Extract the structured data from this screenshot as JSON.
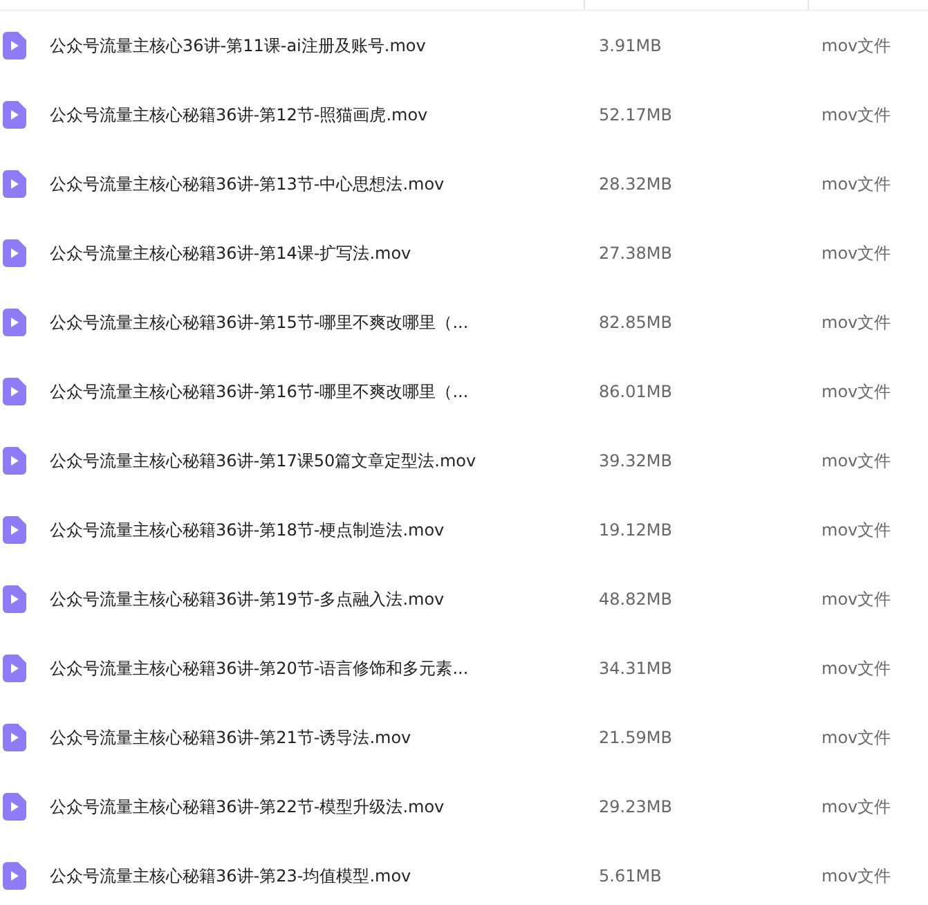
{
  "files": [
    {
      "name": "公众号流量主核心36讲-第11课-ai注册及账号.mov",
      "size": "3.91MB",
      "type": "mov文件"
    },
    {
      "name": "公众号流量主核心秘籍36讲-第12节-照猫画虎.mov",
      "size": "52.17MB",
      "type": "mov文件"
    },
    {
      "name": "公众号流量主核心秘籍36讲-第13节-中心思想法.mov",
      "size": "28.32MB",
      "type": "mov文件"
    },
    {
      "name": "公众号流量主核心秘籍36讲-第14课-扩写法.mov",
      "size": "27.38MB",
      "type": "mov文件"
    },
    {
      "name": "公众号流量主核心秘籍36讲-第15节-哪里不爽改哪里（...",
      "size": "82.85MB",
      "type": "mov文件"
    },
    {
      "name": "公众号流量主核心秘籍36讲-第16节-哪里不爽改哪里（...",
      "size": "86.01MB",
      "type": "mov文件"
    },
    {
      "name": "公众号流量主核心秘籍36讲-第17课50篇文章定型法.mov",
      "size": "39.32MB",
      "type": "mov文件"
    },
    {
      "name": "公众号流量主核心秘籍36讲-第18节-梗点制造法.mov",
      "size": "19.12MB",
      "type": "mov文件"
    },
    {
      "name": "公众号流量主核心秘籍36讲-第19节-多点融入法.mov",
      "size": "48.82MB",
      "type": "mov文件"
    },
    {
      "name": "公众号流量主核心秘籍36讲-第20节-语言修饰和多元素...",
      "size": "34.31MB",
      "type": "mov文件"
    },
    {
      "name": "公众号流量主核心秘籍36讲-第21节-诱导法.mov",
      "size": "21.59MB",
      "type": "mov文件"
    },
    {
      "name": "公众号流量主核心秘籍36讲-第22节-模型升级法.mov",
      "size": "29.23MB",
      "type": "mov文件"
    },
    {
      "name": "公众号流量主核心秘籍36讲-第23-均值模型.mov",
      "size": "5.61MB",
      "type": "mov文件"
    }
  ]
}
